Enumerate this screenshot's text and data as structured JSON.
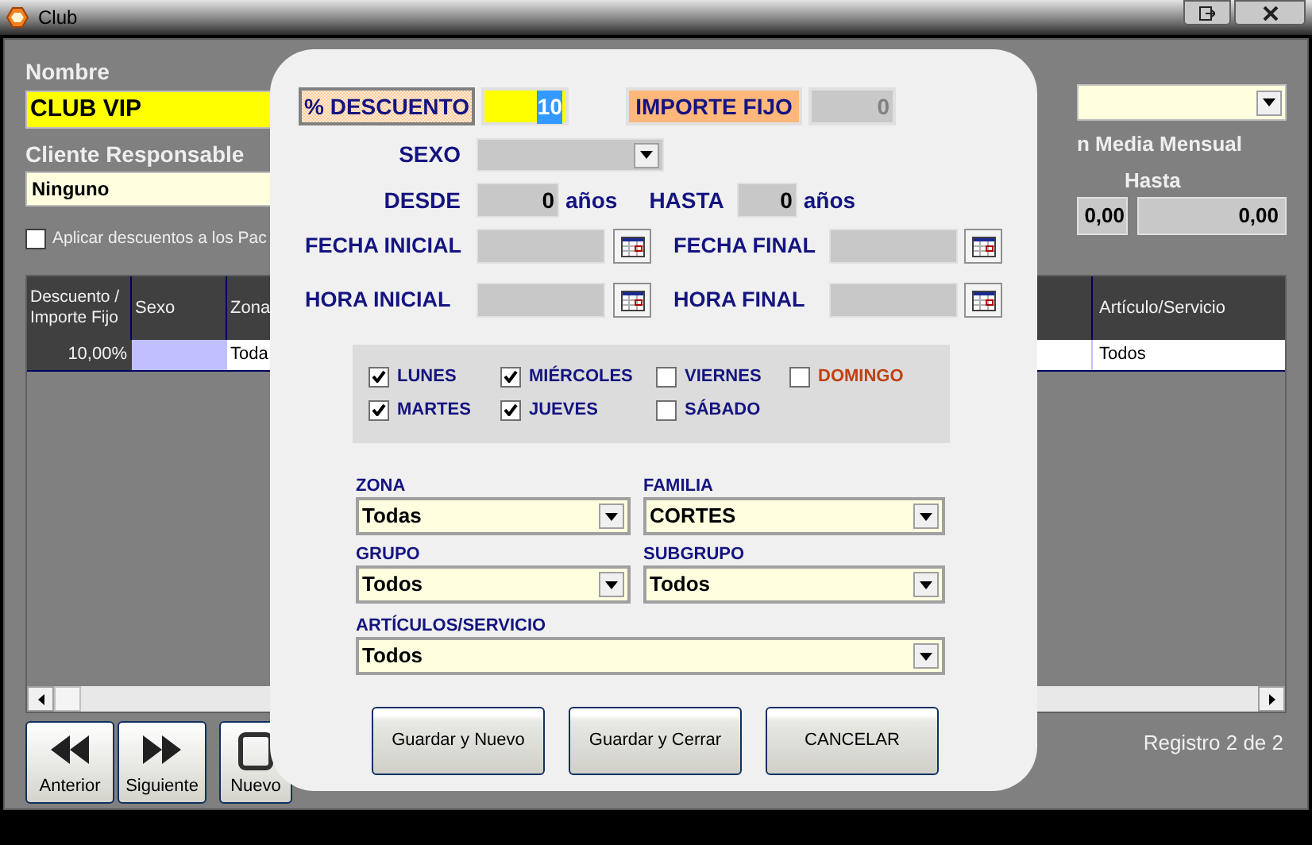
{
  "window": {
    "title": "Club"
  },
  "form": {
    "nombre_label": "Nombre",
    "nombre_value": "CLUB VIP",
    "cliente_label": "Cliente Responsable",
    "cliente_value": "Ninguno",
    "apply_checkbox": {
      "label": "Aplicar descuentos a los Pac",
      "checked": false
    },
    "media_label": "n Media Mensual",
    "hasta_label": "Hasta",
    "desde_value": "0,00",
    "hasta_value": "0,00"
  },
  "table": {
    "columns_left": [
      "Descuento / Importe Fijo",
      "Sexo",
      "Zona"
    ],
    "columns_right": [
      "Artículo/Servicio"
    ],
    "rows": [
      {
        "descuento": "10,00%",
        "zona": "Toda",
        "articulo": "Todos"
      }
    ]
  },
  "nav_buttons": [
    {
      "label": "Anterior",
      "kind": "prev"
    },
    {
      "label": "Siguiente",
      "kind": "next"
    },
    {
      "label": "Nuevo",
      "kind": "new"
    }
  ],
  "status": "Registro 2 de 2",
  "modal": {
    "modes": [
      {
        "label": "% DESCUENTO",
        "selected": true,
        "value": "10"
      },
      {
        "label": "IMPORTE FIJO",
        "selected": false,
        "value": "0"
      }
    ],
    "sexo_label": "SEXO",
    "age": {
      "desde_label": "DESDE",
      "desde_value": "0",
      "hasta_label": "HASTA",
      "hasta_value": "0",
      "unit_1": "años",
      "unit_2": "años"
    },
    "date_rows": [
      {
        "label_1": "FECHA INICIAL",
        "label_2": "FECHA FINAL"
      },
      {
        "label_1": "HORA INICIAL",
        "label_2": "HORA FINAL"
      }
    ],
    "days": [
      {
        "label": "LUNES",
        "checked": true,
        "color": "#141480"
      },
      {
        "label": "MIÉRCOLES",
        "checked": true,
        "color": "#141480"
      },
      {
        "label": "VIERNES",
        "checked": false,
        "color": "#141480"
      },
      {
        "label": "DOMINGO",
        "checked": false,
        "color": "#c04010"
      },
      {
        "label": "MARTES",
        "checked": true,
        "color": "#141480"
      },
      {
        "label": "JUEVES",
        "checked": true,
        "color": "#141480"
      },
      {
        "label": "SÁBADO",
        "checked": false,
        "color": "#141480"
      }
    ],
    "combos": [
      {
        "label": "ZONA",
        "value": "Todas",
        "kind": "half"
      },
      {
        "label": "FAMILIA",
        "value": "CORTES",
        "kind": "half"
      },
      {
        "label": "GRUPO",
        "value": "Todos",
        "kind": "half"
      },
      {
        "label": "SUBGRUPO",
        "value": "Todos",
        "kind": "half"
      },
      {
        "label": "ARTÍCULOS/SERVICIO",
        "value": "Todos",
        "kind": "full"
      }
    ],
    "buttons": [
      "Guardar y Nuevo",
      "Guardar y Cerrar",
      "CANCELAR"
    ]
  }
}
